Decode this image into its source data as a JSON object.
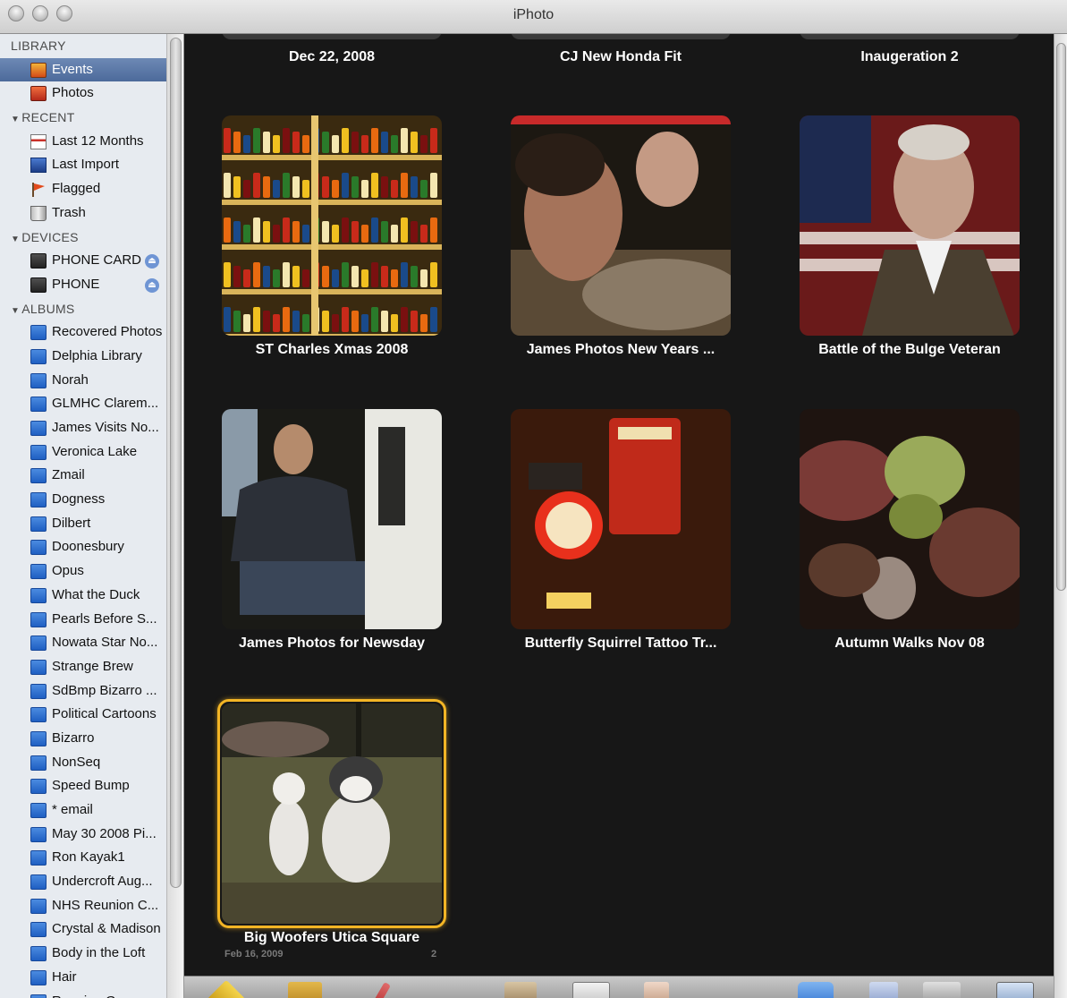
{
  "window": {
    "title": "iPhoto"
  },
  "sidebar": {
    "sections": [
      {
        "header": "LIBRARY",
        "triangle": false,
        "items": [
          {
            "label": "Events",
            "icon": "events-icon",
            "selected": true
          },
          {
            "label": "Photos",
            "icon": "photos-icon"
          }
        ]
      },
      {
        "header": "RECENT",
        "triangle": true,
        "items": [
          {
            "label": "Last 12 Months",
            "icon": "calendar-icon"
          },
          {
            "label": "Last Import",
            "icon": "import-icon"
          },
          {
            "label": "Flagged",
            "icon": "flag-icon"
          },
          {
            "label": "Trash",
            "icon": "trash-icon"
          }
        ]
      },
      {
        "header": "DEVICES",
        "triangle": true,
        "items": [
          {
            "label": "PHONE CARD",
            "icon": "device-icon",
            "eject": true
          },
          {
            "label": "PHONE",
            "icon": "device-icon",
            "eject": true
          }
        ]
      },
      {
        "header": "ALBUMS",
        "triangle": true,
        "items": [
          {
            "label": "Recovered Photos",
            "icon": "album-icon"
          },
          {
            "label": "Delphia Library",
            "icon": "album-icon"
          },
          {
            "label": "Norah",
            "icon": "album-icon"
          },
          {
            "label": "GLMHC Clarem...",
            "icon": "album-icon"
          },
          {
            "label": "James Visits No...",
            "icon": "album-icon"
          },
          {
            "label": "Veronica Lake",
            "icon": "album-icon"
          },
          {
            "label": "Zmail",
            "icon": "album-icon"
          },
          {
            "label": "Dogness",
            "icon": "album-icon"
          },
          {
            "label": "Dilbert",
            "icon": "album-icon"
          },
          {
            "label": "Doonesbury",
            "icon": "album-icon"
          },
          {
            "label": "Opus",
            "icon": "album-icon"
          },
          {
            "label": "What the Duck",
            "icon": "album-icon"
          },
          {
            "label": "Pearls Before S...",
            "icon": "album-icon"
          },
          {
            "label": "Nowata Star No...",
            "icon": "album-icon"
          },
          {
            "label": "Strange Brew",
            "icon": "album-icon"
          },
          {
            "label": "SdBmp Bizarro ...",
            "icon": "album-icon"
          },
          {
            "label": "Political Cartoons",
            "icon": "album-icon"
          },
          {
            "label": "Bizarro",
            "icon": "album-icon"
          },
          {
            "label": "NonSeq",
            "icon": "album-icon"
          },
          {
            "label": "Speed Bump",
            "icon": "album-icon"
          },
          {
            "label": "* email",
            "icon": "album-icon"
          },
          {
            "label": "May 30 2008 Pi...",
            "icon": "album-icon"
          },
          {
            "label": "Ron Kayak1",
            "icon": "album-icon"
          },
          {
            "label": "Undercroft Aug...",
            "icon": "album-icon"
          },
          {
            "label": "NHS Reunion C...",
            "icon": "album-icon"
          },
          {
            "label": "Crystal & Madison",
            "icon": "album-icon"
          },
          {
            "label": "Body in the Loft",
            "icon": "album-icon"
          },
          {
            "label": "Hair",
            "icon": "album-icon"
          },
          {
            "label": "Running Group",
            "icon": "album-icon"
          }
        ]
      }
    ]
  },
  "events": {
    "top_row": [
      "Dec 22, 2008",
      "CJ New Honda Fit",
      "Inaugeration 2"
    ],
    "grid": [
      {
        "title": "ST Charles Xmas 2008",
        "scene": "shelves"
      },
      {
        "title": "James Photos New Years ...",
        "scene": "swimmers"
      },
      {
        "title": "Battle of the Bulge Veteran",
        "scene": "veteran"
      },
      {
        "title": "James Photos for Newsday",
        "scene": "porch"
      },
      {
        "title": "Butterfly Squirrel Tattoo Tr...",
        "scene": "signs"
      },
      {
        "title": "Autumn Walks Nov 08",
        "scene": "leaves"
      },
      {
        "title": "Big Woofers Utica Square",
        "scene": "dogs",
        "selected": true,
        "date": "Feb 16, 2009",
        "count": "2"
      }
    ]
  },
  "colors": {
    "selection_ring": "#f3b525",
    "sidebar_bg": "#e7ebf0",
    "sidebar_selected": "#5676a8",
    "grid_bg": "#171717"
  }
}
